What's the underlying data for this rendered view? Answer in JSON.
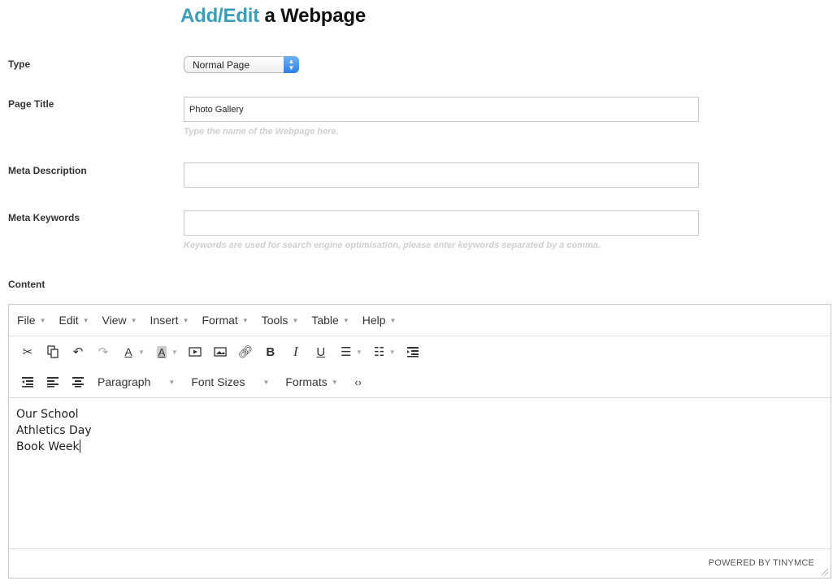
{
  "title": {
    "accent": "Add/Edit",
    "rest": "a Webpage"
  },
  "form": {
    "type_label": "Type",
    "type_value": "Normal Page",
    "page_title_label": "Page Title",
    "page_title_value": "Photo Gallery",
    "page_title_hint": "Type the name of the Webpage here.",
    "meta_description_label": "Meta Description",
    "meta_description_value": "",
    "meta_keywords_label": "Meta Keywords",
    "meta_keywords_value": "",
    "meta_keywords_hint": "Keywords are used for search engine optimisation, please enter keywords separated by a comma.",
    "content_label": "Content"
  },
  "editor": {
    "menu": [
      "File",
      "Edit",
      "View",
      "Insert",
      "Format",
      "Tools",
      "Table",
      "Help"
    ],
    "dropdowns": {
      "paragraph": "Paragraph",
      "font_sizes": "Font Sizes",
      "formats": "Formats"
    },
    "content_lines": [
      "Our School",
      "Athletics Day",
      "Book Week"
    ],
    "powered_by": "POWERED BY TINYMCE"
  }
}
